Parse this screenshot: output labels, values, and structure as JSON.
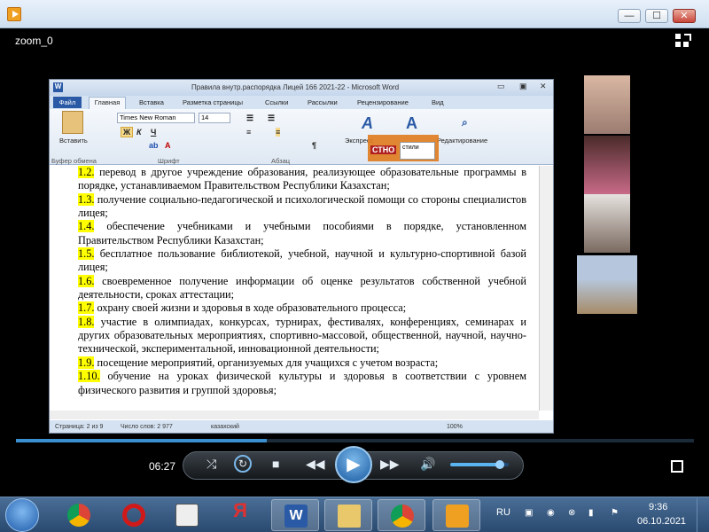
{
  "window": {
    "title": "zoom_0",
    "minimize": "—",
    "maximize": "☐",
    "close": "✕"
  },
  "word": {
    "title": "Правила внутр.распорядка Лицей 166 2021-22 - Microsoft Word",
    "tabs": [
      "Файл",
      "Главная",
      "Вставка",
      "Разметка страницы",
      "Ссылки",
      "Рассылки",
      "Рецензирование",
      "Вид"
    ],
    "font_name": "Times New Roman",
    "font_size": "14",
    "ribbon_labels": {
      "paste": "Вставить",
      "clipboard": "Буфер обмена",
      "font": "Шрифт",
      "paragraph": "Абзац",
      "express": "Экспресс",
      "styles": "стили",
      "edit": "Редактирование",
      "bold": "Ж",
      "italic": "К",
      "underline": "Ч",
      "change_styles": "Изменить"
    },
    "overlay_text": "СТНО",
    "paragraphs": [
      {
        "num": "1.2.",
        "text": " перевод в другое учреждение образования, реализующее образовательные программы в порядке, устанавливаемом Правительством Республики Казахстан;"
      },
      {
        "num": "1.3.",
        "text": " получение социально-педагогической и психологической помощи со стороны специалистов лицея;"
      },
      {
        "num": "1.4.",
        "text": " обеспечение учебниками и учебными пособиями в порядке, установленном Правительством Республики Казахстан;"
      },
      {
        "num": "1.5.",
        "text": " бесплатное пользование библиотекой, учебной, научной и культурно-спортивной базой лицея;"
      },
      {
        "num": "1.6.",
        "text": " своевременное получение информации об оценке результатов собственной учебной деятельности, сроках аттестации;"
      },
      {
        "num": "1.7.",
        "text": " охрану своей жизни и здоровья в ходе образовательного процесса;"
      },
      {
        "num": "1.8.",
        "text": " участие в олимпиадах, конкурсах, турнирах, фестивалях, конференциях, семинарах и других образовательных мероприятиях, спортивно-массовой, общественной, научной, научно- технической, экспериментальной, инновационной деятельности;"
      },
      {
        "num": "1.9.",
        "text": " посещение мероприятий, организуемых для учащихся с учетом возраста;"
      },
      {
        "num": "1.10.",
        "text": " обучение на уроках физической культуры и здоровья в соответствии с уровнем физического развития и группой здоровья;"
      }
    ],
    "status": {
      "page": "Страница: 2 из 9",
      "words": "Число слов: 2 977",
      "lang": "казахский",
      "zoom": "100%"
    }
  },
  "player": {
    "time": "06:27",
    "progress": 0.37,
    "volume": 0.85
  },
  "taskbar": {
    "lang": "RU",
    "time": "9:36",
    "date": "06.10.2021"
  }
}
